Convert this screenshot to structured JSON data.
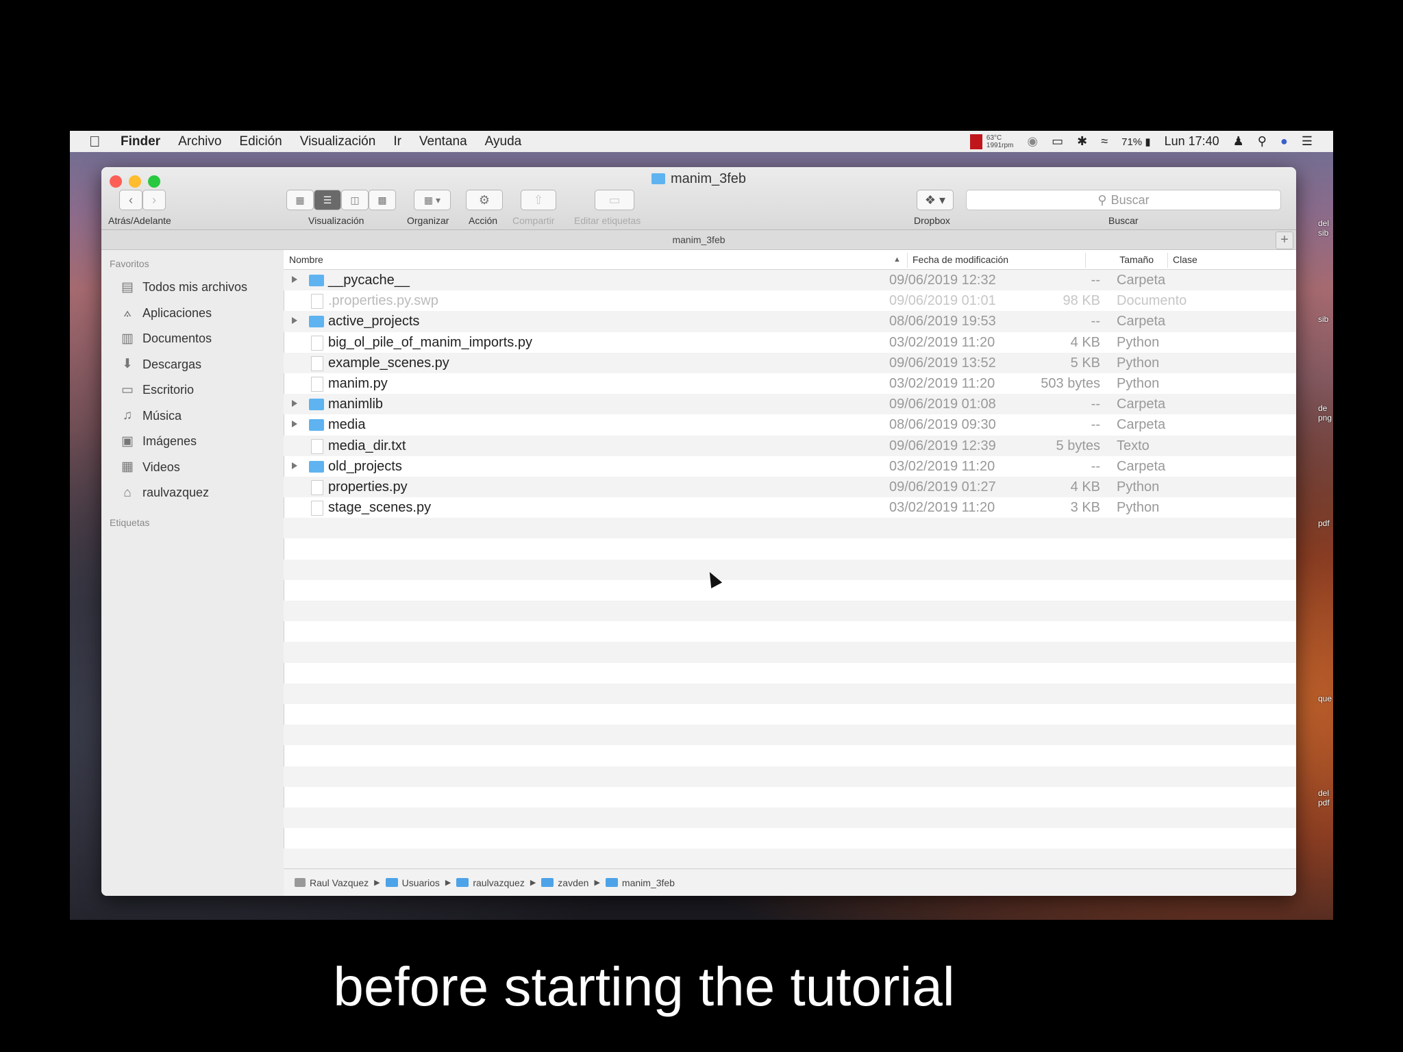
{
  "menubar": {
    "items": [
      "Finder",
      "Archivo",
      "Edición",
      "Visualización",
      "Ir",
      "Ventana",
      "Ayuda"
    ],
    "temp": "63°C",
    "rpm": "1991rpm",
    "battery": "71%",
    "clock": "Lun 17:40"
  },
  "window": {
    "title": "manim_3feb",
    "nav_label": "Atrás/Adelante",
    "toolbar_labels": {
      "view": "Visualización",
      "arrange": "Organizar",
      "action": "Acción",
      "share": "Compartir",
      "tags": "Editar etiquetas",
      "dropbox": "Dropbox",
      "search": "Buscar"
    },
    "search_placeholder": "Buscar",
    "path_title": "manim_3feb"
  },
  "sidebar": {
    "favorites_heading": "Favoritos",
    "items": [
      {
        "label": "Todos mis archivos",
        "icon": "all-files-icon"
      },
      {
        "label": "Aplicaciones",
        "icon": "applications-icon"
      },
      {
        "label": "Documentos",
        "icon": "documents-icon"
      },
      {
        "label": "Descargas",
        "icon": "downloads-icon"
      },
      {
        "label": "Escritorio",
        "icon": "desktop-icon"
      },
      {
        "label": "Música",
        "icon": "music-icon"
      },
      {
        "label": "Imágenes",
        "icon": "pictures-icon"
      },
      {
        "label": "Videos",
        "icon": "movies-icon"
      },
      {
        "label": "raulvazquez",
        "icon": "home-icon"
      }
    ],
    "tags_heading": "Etiquetas"
  },
  "columns": {
    "name": "Nombre",
    "date": "Fecha de modificación",
    "size": "Tamaño",
    "kind": "Clase"
  },
  "files": [
    {
      "name": "__pycache__",
      "date": "09/06/2019 12:32",
      "size": "--",
      "kind": "Carpeta",
      "folder": true
    },
    {
      "name": ".properties.py.swp",
      "date": "09/06/2019 01:01",
      "size": "98 KB",
      "kind": "Documento",
      "folder": false,
      "dim": true
    },
    {
      "name": "active_projects",
      "date": "08/06/2019 19:53",
      "size": "--",
      "kind": "Carpeta",
      "folder": true
    },
    {
      "name": "big_ol_pile_of_manim_imports.py",
      "date": "03/02/2019 11:20",
      "size": "4 KB",
      "kind": "Python",
      "folder": false
    },
    {
      "name": "example_scenes.py",
      "date": "09/06/2019 13:52",
      "size": "5 KB",
      "kind": "Python",
      "folder": false
    },
    {
      "name": "manim.py",
      "date": "03/02/2019 11:20",
      "size": "503 bytes",
      "kind": "Python",
      "folder": false
    },
    {
      "name": "manimlib",
      "date": "09/06/2019 01:08",
      "size": "--",
      "kind": "Carpeta",
      "folder": true
    },
    {
      "name": "media",
      "date": "08/06/2019 09:30",
      "size": "--",
      "kind": "Carpeta",
      "folder": true
    },
    {
      "name": "media_dir.txt",
      "date": "09/06/2019 12:39",
      "size": "5 bytes",
      "kind": "Texto",
      "folder": false
    },
    {
      "name": "old_projects",
      "date": "03/02/2019 11:20",
      "size": "--",
      "kind": "Carpeta",
      "folder": true
    },
    {
      "name": "properties.py",
      "date": "09/06/2019 01:27",
      "size": "4 KB",
      "kind": "Python",
      "folder": false
    },
    {
      "name": "stage_scenes.py",
      "date": "03/02/2019 11:20",
      "size": "3 KB",
      "kind": "Python",
      "folder": false
    }
  ],
  "pathbar": [
    "Raul Vazquez",
    "Usuarios",
    "raulvazquez",
    "zavden",
    "manim_3feb"
  ],
  "caption": "before starting the tutorial"
}
